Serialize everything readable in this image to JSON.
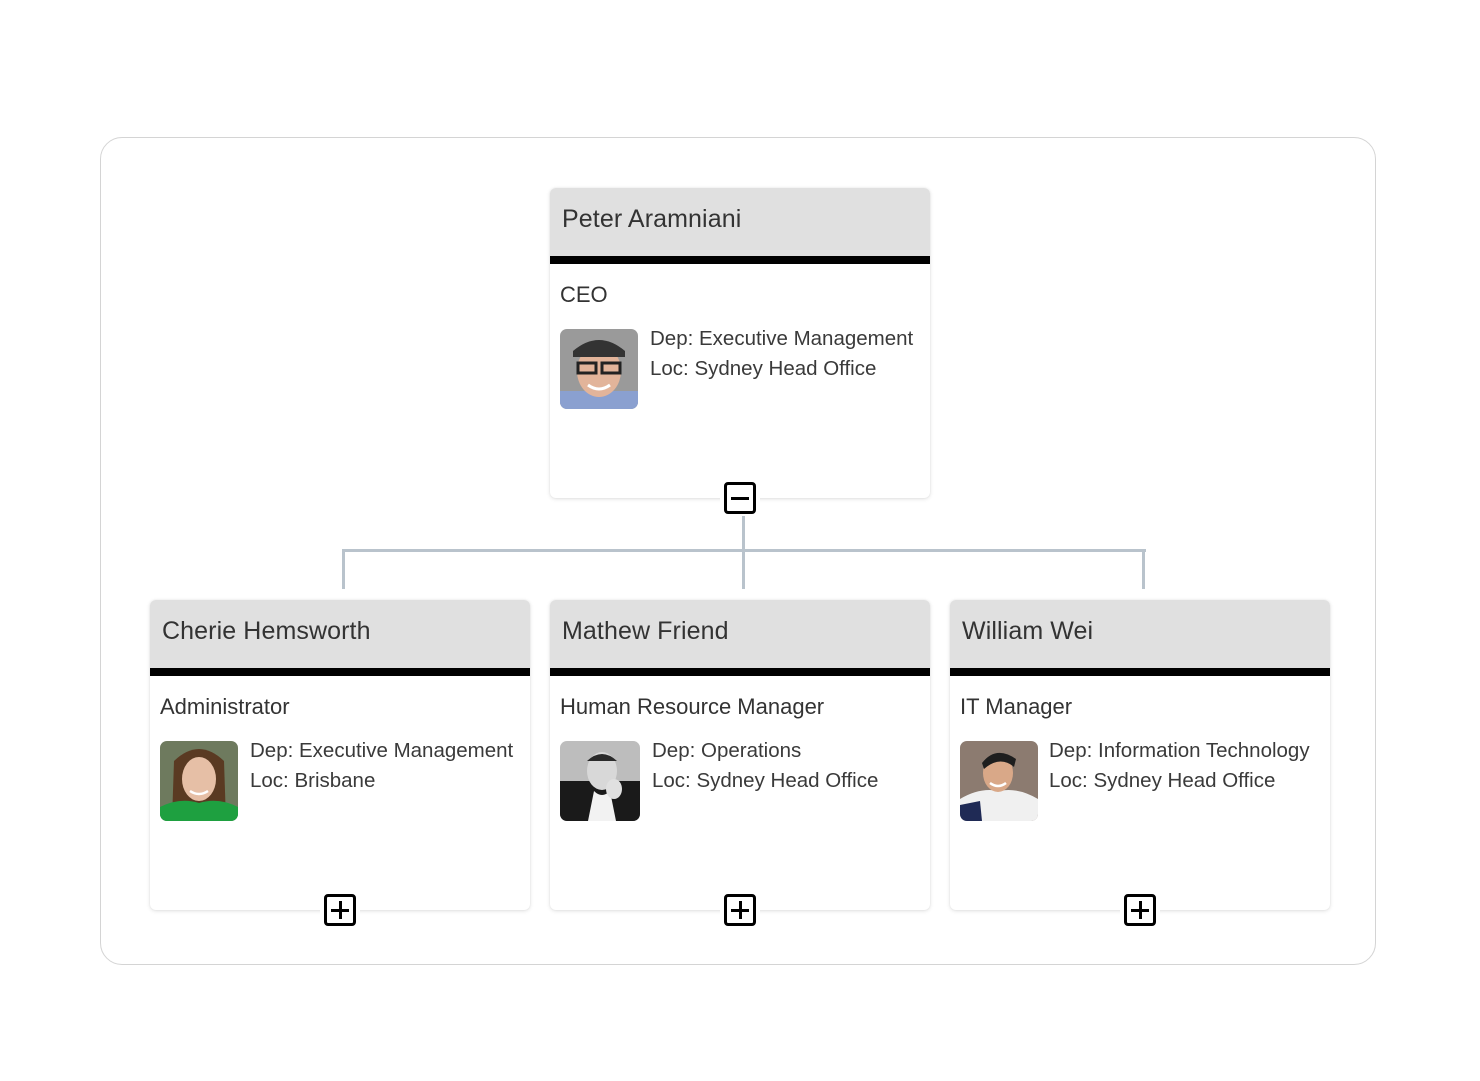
{
  "org_chart": {
    "root": {
      "name": "Peter Aramniani",
      "title": "CEO",
      "department": "Dep: Executive Management",
      "location": "Loc: Sydney Head Office",
      "photo": "photo-man-glasses-cap",
      "toggle": "collapse-icon"
    },
    "children": [
      {
        "name": "Cherie Hemsworth",
        "title": "Administrator",
        "department": "Dep: Executive Management",
        "location": "Loc: Brisbane",
        "photo": "photo-woman-green",
        "toggle": "expand-icon"
      },
      {
        "name": "Mathew Friend",
        "title": "Human Resource Manager",
        "department": "Dep: Operations",
        "location": "Loc: Sydney Head Office",
        "photo": "photo-man-bw",
        "toggle": "expand-icon"
      },
      {
        "name": "William Wei",
        "title": "IT Manager",
        "department": "Dep: Information Technology",
        "location": "Loc: Sydney Head Office",
        "photo": "photo-man-white-shirt",
        "toggle": "expand-icon"
      }
    ],
    "colors": {
      "header_bg": "#e0e0e0",
      "header_bar": "#000000",
      "connector": "#b9c3cc",
      "text": "#333333"
    }
  }
}
